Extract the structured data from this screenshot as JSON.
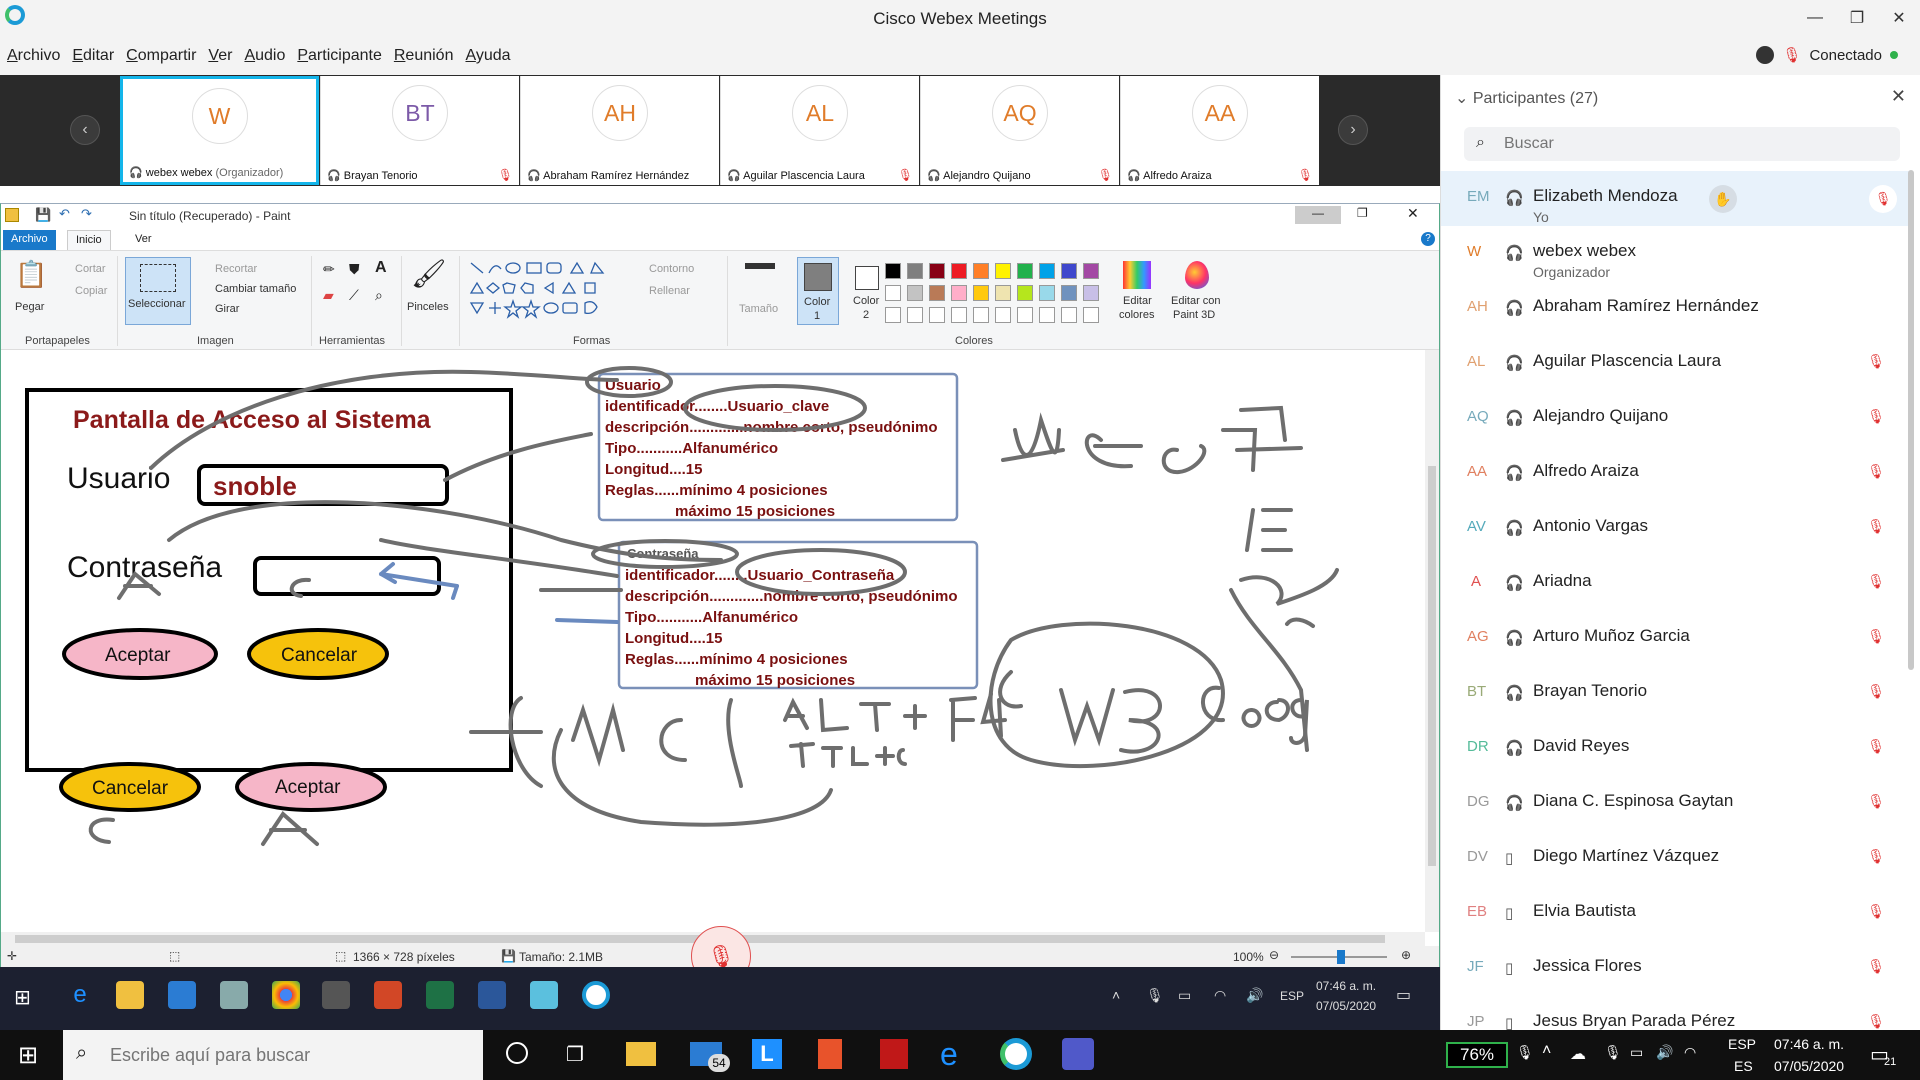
{
  "window": {
    "title": "Cisco Webex Meetings"
  },
  "menu": [
    "Archivo",
    "Editar",
    "Compartir",
    "Ver",
    "Audio",
    "Participante",
    "Reunión",
    "Ayuda"
  ],
  "status": {
    "connection": "Conectado"
  },
  "video_tiles": [
    {
      "initials": "W",
      "name": "webex webex",
      "role": "(Organizador)",
      "active": true
    },
    {
      "initials": "BT",
      "name": "Brayan Tenorio",
      "role": ""
    },
    {
      "initials": "AH",
      "name": "Abraham Ramírez Hernández",
      "role": ""
    },
    {
      "initials": "AL",
      "name": "Aguilar Plascencia Laura",
      "role": ""
    },
    {
      "initials": "AQ",
      "name": "Alejandro Quijano",
      "role": ""
    },
    {
      "initials": "AA",
      "name": "Alfredo Araiza",
      "role": ""
    }
  ],
  "panel": {
    "title": "Participantes (27)",
    "search_placeholder": "Buscar",
    "participants": [
      {
        "initials": "EM",
        "name": "Elizabeth Mendoza",
        "role": "Yo"
      },
      {
        "initials": "W",
        "name": "webex webex",
        "role": "Organizador"
      },
      {
        "initials": "AH",
        "name": "Abraham Ramírez Hernández",
        "role": ""
      },
      {
        "initials": "AL",
        "name": "Aguilar Plascencia Laura",
        "role": ""
      },
      {
        "initials": "AQ",
        "name": "Alejandro Quijano",
        "role": ""
      },
      {
        "initials": "AA",
        "name": "Alfredo Araiza",
        "role": ""
      },
      {
        "initials": "AV",
        "name": "Antonio Vargas",
        "role": ""
      },
      {
        "initials": "A",
        "name": "Ariadna",
        "role": ""
      },
      {
        "initials": "AG",
        "name": "Arturo Muñoz Garcia",
        "role": ""
      },
      {
        "initials": "BT",
        "name": "Brayan Tenorio",
        "role": ""
      },
      {
        "initials": "DR",
        "name": "David Reyes",
        "role": ""
      },
      {
        "initials": "DG",
        "name": "Diana C. Espinosa Gaytan",
        "role": ""
      },
      {
        "initials": "DV",
        "name": "Diego Martínez Vázquez",
        "role": ""
      },
      {
        "initials": "EB",
        "name": "Elvia Bautista",
        "role": ""
      },
      {
        "initials": "JF",
        "name": "Jessica Flores",
        "role": ""
      },
      {
        "initials": "JP",
        "name": "Jesus Bryan Parada Pérez",
        "role": ""
      }
    ]
  },
  "paint": {
    "title": "Sin título (Recuperado) - Paint",
    "tabs": [
      "Archivo",
      "Inicio",
      "Ver"
    ],
    "ribbon": {
      "pegar": "Pegar",
      "cortar": "Cortar",
      "copiar": "Copiar",
      "seleccionar": "Seleccionar",
      "recortar": "Recortar",
      "cambiar_tamano": "Cambiar tamaño",
      "girar": "Girar",
      "pinceles": "Pinceles",
      "contorno": "Contorno",
      "rellenar": "Rellenar",
      "tamano": "Tamaño",
      "color1": "Color",
      "color1_n": "1",
      "color2": "Color",
      "color2_n": "2",
      "editar_colores_1": "Editar",
      "editar_colores_2": "colores",
      "paint3d_1": "Editar con",
      "paint3d_2": "Paint 3D",
      "groups": [
        "Portapapeles",
        "Imagen",
        "Herramientas",
        "Formas",
        "Colores"
      ]
    },
    "status": {
      "dimensions": "1366 × 728 píxeles",
      "size": "Tamaño: 2.1MB",
      "zoom": "100%"
    },
    "palette": [
      "#000000",
      "#7f7f7f",
      "#880015",
      "#ed1c24",
      "#ff7f27",
      "#fff200",
      "#22b14c",
      "#00a2e8",
      "#3f48cc",
      "#a349a4",
      "#ffffff",
      "#c3c3c3",
      "#b97a57",
      "#ffaec9",
      "#ffc90e",
      "#efe4b0",
      "#b5e61d",
      "#99d9ea",
      "#7092be",
      "#c8bfe7"
    ],
    "drawing": {
      "screen_title": "Pantalla de Acceso al Sistema",
      "user_label": "Usuario",
      "user_value": "snoble",
      "pass_label": "Contraseña",
      "btn_accept": "Aceptar",
      "btn_cancel": "Cancelar",
      "box1": [
        "Usuario",
        "identificador........Usuario_clave",
        "descripción.............nombre corto, pseudónimo",
        "Tipo...........Alfanumérico",
        "Longitud....15",
        "Reglas......mínimo 4 posiciones",
        "máximo 15 posiciones"
      ],
      "box2": [
        "Contraseña",
        "identificador........Usuario_Contraseña",
        "descripción.............nombre corto, pseudónimo",
        "Tipo...........Alfanumérico",
        "Longitud....15",
        "Reglas......mínimo 4 posiciones",
        "máximo 15 posiciones"
      ],
      "hand_notes": [
        "A",
        "C",
        "MFC",
        "ALT + F4",
        "CTRL+C",
        "w3c.org",
        "IE",
        "A&"
      ]
    }
  },
  "inner_tray": {
    "lang": "ESP",
    "time": "07:46 a. m.",
    "date": "07/05/2020"
  },
  "taskbar": {
    "search_placeholder": "Escribe aquí para buscar",
    "mail_badge": "54",
    "battery": "76%",
    "lang1": "ESP",
    "lang2": "ES",
    "time": "07:46 a. m.",
    "date": "07/05/2020",
    "notif": "21"
  }
}
